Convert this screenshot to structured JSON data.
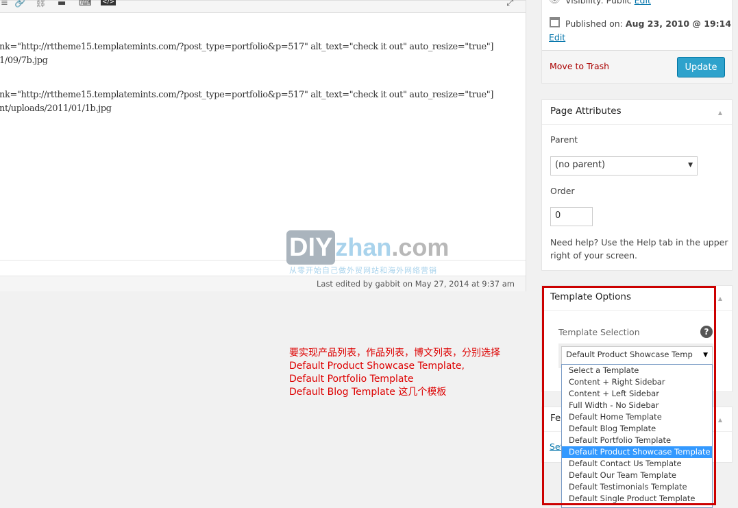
{
  "editor": {
    "toolbar_icons": [
      "link-icon",
      "unlink-icon",
      "more-tag-icon",
      "keyboard-icon",
      "code-icon",
      "fullscreen-icon"
    ],
    "content_lines": [
      "nk=\"http://rttheme15.templatemints.com/?post_type=portfolio&p=517\" alt_text=\"check it out\" auto_resize=\"true\"]",
      "1/09/7b.jpg",
      "",
      "nk=\"http://rttheme15.templatemints.com/?post_type=portfolio&p=517\" alt_text=\"check it out\" auto_resize=\"true\"]",
      "nt/uploads/2011/01/1b.jpg"
    ],
    "last_edited": "Last edited by gabbit on May 27, 2014 at 9:37 am"
  },
  "watermark": {
    "diy": "DIY",
    "zhan": "zhan",
    ".com": ".com",
    "tagline": "从零开始自己做外贸网站和海外网络营销"
  },
  "publish": {
    "visibility_label": "Visibility: Public",
    "visibility_edit": "Edit",
    "published_label": "Published on:",
    "published_date": "Aug 23, 2010 @ 19:14",
    "published_edit": "Edit",
    "trash": "Move to Trash",
    "update": "Update"
  },
  "page_attributes": {
    "title": "Page Attributes",
    "parent_label": "Parent",
    "parent_value": "(no parent)",
    "order_label": "Order",
    "order_value": "0",
    "help": "Need help? Use the Help tab in the upper right of your screen."
  },
  "template_options": {
    "title": "Template Options",
    "selection_label": "Template Selection",
    "selected": "Default Product Showcase Temp",
    "options": [
      "Select a Template",
      "Content + Right Sidebar",
      "Content + Left Sidebar",
      "Full Width - No Sidebar",
      "Default Home Template",
      "Default Blog Template",
      "Default Portfolio Template",
      "Default Product Showcase Template",
      "Default Contact Us Template",
      "Default Our Team Template",
      "Default Testimonials Template",
      "Default Single Product Template"
    ],
    "highlighted_index": 7
  },
  "featured": {
    "title": "Fea",
    "link": "Set"
  },
  "annotation": [
    "要实现产品列表，作品列表，博文列表，分别选择",
    "Default Product Showcase Template,",
    "Default Portfolio Template",
    "Default Blog Template 这几个模板"
  ],
  "colors": {
    "accent": "#2ea2cc",
    "annotation": "#dd0000",
    "frame": "#cc0000",
    "highlight": "#3399ff"
  }
}
